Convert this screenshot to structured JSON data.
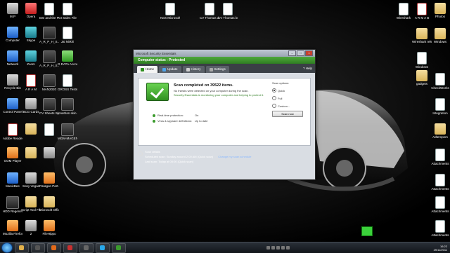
{
  "desktop": {
    "icons": [
      {
        "label": "M.P",
        "glyph": "g-gray"
      },
      {
        "label": "Opera",
        "glyph": "g-red"
      },
      {
        "label": "BSI and the Prog",
        "glyph": "g-doc"
      },
      {
        "label": "GI Sales File",
        "glyph": "g-doc"
      },
      {
        "label": "Computer",
        "glyph": "g-blue"
      },
      {
        "label": "Skype",
        "glyph": "g-teal"
      },
      {
        "label": "A_R_P_H_S... Andreas",
        "glyph": "g-dark"
      },
      {
        "label": "Jai Nirkhi",
        "glyph": "g-doc"
      },
      {
        "label": "Network",
        "glyph": "g-blue"
      },
      {
        "label": "Zoom",
        "glyph": "g-teal"
      },
      {
        "label": "A_R_P_H_S...",
        "glyph": "g-dark"
      },
      {
        "label": "G DATA Accounting",
        "glyph": "g-green"
      },
      {
        "label": "Recycle Bin",
        "glyph": "g-gray"
      },
      {
        "label": "A R A M",
        "glyph": "g-pdf"
      },
      {
        "label": "MAN2020",
        "glyph": "g-dark"
      },
      {
        "label": "GROSS Tests",
        "glyph": "g-doc"
      },
      {
        "label": "Control Panel",
        "glyph": "g-blue"
      },
      {
        "label": "BCG Cards",
        "glyph": "g-gray"
      },
      {
        "label": "CV Sheets Worksheet",
        "glyph": "g-dark"
      },
      {
        "label": "jonathan skin...",
        "glyph": "g-dark"
      },
      {
        "label": "Adobe Reader X",
        "glyph": "g-pdf"
      },
      {
        "label": "",
        "glyph": "g-folder"
      },
      {
        "label": "",
        "glyph": "g-doc"
      },
      {
        "label": "MGM-MAGEN",
        "glyph": "g-dark"
      },
      {
        "label": "GOM Player",
        "glyph": "g-orange"
      },
      {
        "label": "",
        "glyph": "g-folder"
      },
      {
        "label": "",
        "glyph": "g-gray"
      },
      {
        "label": "MusicBee",
        "glyph": "g-blue"
      },
      {
        "label": "Sony Vegas",
        "glyph": "g-gray"
      },
      {
        "label": "Paragon Part...",
        "glyph": "g-orange"
      },
      {
        "label": "HDD Regenerator",
        "glyph": "g-dark"
      },
      {
        "label": "Script Tool Filebot",
        "glyph": "g-folder"
      },
      {
        "label": "Microsoft Office 2010",
        "glyph": "g-folder"
      },
      {
        "label": "Mozilla Firefox",
        "glyph": "g-orange"
      },
      {
        "label": "2",
        "glyph": "g-gray"
      },
      {
        "label": "FileHippo",
        "glyph": "g-orange"
      },
      {
        "label": "New Microsoft",
        "glyph": "g-doc"
      },
      {
        "label": "CV Thomas docx",
        "glyph": "g-doc"
      },
      {
        "label": "CV Thomas bmp",
        "glyph": "g-doc"
      },
      {
        "label": "Wireshark",
        "glyph": "g-doc"
      },
      {
        "label": "A R M A B",
        "glyph": "g-pdf"
      },
      {
        "label": "Photos",
        "glyph": "g-folder"
      },
      {
        "label": "Wireshark release 2.0",
        "glyph": "g-folder"
      },
      {
        "label": "Windows",
        "glyph": "g-folder"
      },
      {
        "label": "Windows",
        "glyph": "g-doc"
      },
      {
        "label": "gadgets",
        "glyph": "g-folder"
      },
      {
        "label": "CheckWorks",
        "glyph": "g-doc"
      },
      {
        "label": "Integration",
        "glyph": "g-doc"
      },
      {
        "label": "Adtempers",
        "glyph": "g-folder"
      },
      {
        "label": "Attachments",
        "glyph": "g-doc"
      },
      {
        "label": "Attachments",
        "glyph": "g-doc"
      },
      {
        "label": "Attachments",
        "glyph": "g-doc"
      },
      {
        "label": "Attachments",
        "glyph": "g-doc"
      }
    ]
  },
  "window": {
    "title": "Microsoft Security Essentials",
    "status": "Computer status - Protected",
    "tabs": [
      "Home",
      "Update",
      "History",
      "Settings"
    ],
    "help": "Help",
    "scan_heading": "Scan completed on 39522 items.",
    "scan_msg1": "No threats were detected on your computer during the scan.",
    "scan_msg2": "Security Essentials is monitoring your computer and helping to protect it.",
    "status_rows": [
      {
        "label": "Real-time protection:",
        "value": "On"
      },
      {
        "label": "Virus & spyware definitions:",
        "value": "Up to date"
      }
    ],
    "scan_options_title": "Scan options:",
    "scan_options": [
      "Quick",
      "Full",
      "Custom..."
    ],
    "scan_button": "Scan now",
    "details_title": "Scan details",
    "details_scheduled": "Scheduled scan: Sunday around 2:00 AM (Quick scan)",
    "details_change": "Change my scan schedule",
    "details_last": "Last scan: Today at 05:00 (Quick scan)"
  },
  "taskbar": {
    "clock_time": "16:22",
    "clock_date": "29/11/2011"
  }
}
